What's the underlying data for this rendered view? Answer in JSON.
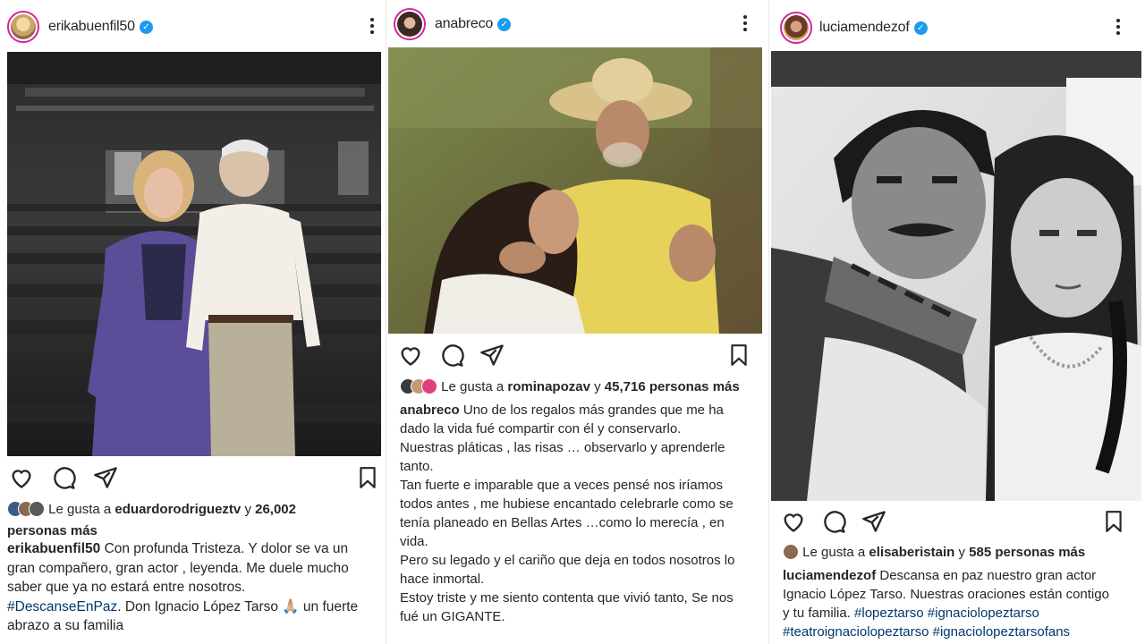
{
  "posts": [
    {
      "username": "erikabuenfil50",
      "likes_prefix": "Le gusta a",
      "liked_by": "eduardorodrigueztv",
      "likes_mid": "y",
      "likes_count": "26,002",
      "likes_suffix": "personas más",
      "caption_user": "erikabuenfil50",
      "caption_lines": [
        "Con profunda Tristeza. Y dolor se va un",
        "gran compañero, gran actor , leyenda. Me duele mucho",
        "saber que ya no estará entre nosotros."
      ],
      "hashtag": "#DescanseEnPaz",
      "caption_tail": ". Don Ignacio López Tarso 🙏🏼 un fuerte",
      "caption_last": "abrazo a su familia"
    },
    {
      "username": "anabreco",
      "likes_prefix": "Le gusta a",
      "liked_by": "rominapozav",
      "likes_mid": "y",
      "likes_count": "45,716 personas más",
      "caption_user": "anabreco",
      "caption_first": "Uno de los regalos más grandes que me ha",
      "caption_lines": [
        "dado la vida fué compartir con él y conservarlo.",
        "Nuestras pláticas , las risas … observarlo y aprenderle",
        "tanto.",
        "Tan fuerte e imparable que a veces pensé nos iríamos",
        "todos antes , me hubiese encantado celebrarle como se",
        "tenía planeado en Bellas Artes …como lo merecía , en",
        "vida.",
        "Pero su legado y el cariño que deja en todos nosotros lo",
        "hace inmortal.",
        "Estoy triste y me siento contenta que vivió tanto, Se nos",
        "fué un GIGANTE."
      ]
    },
    {
      "username": "luciamendezof",
      "likes_prefix": "Le gusta a",
      "liked_by": "elisaberistain",
      "likes_mid": "y",
      "likes_count": "585 personas más",
      "caption_user": "luciamendezof",
      "caption_first": "Descansa en paz nuestro gran actor",
      "caption_lines": [
        "Ignacio López Tarso. Nuestras oraciones están contigo"
      ],
      "caption_third": "y tu familia.",
      "hashtags": [
        "#lopeztarso",
        "#ignaciolopeztarso",
        "#teatroignaciolopeztarso",
        "#ignaciolopeztarsofans"
      ]
    }
  ],
  "colors": {
    "text": "#262626",
    "hashtag": "#00376b",
    "verified": "#1d9bf0"
  },
  "icons": [
    "heart-icon",
    "comment-icon",
    "share-icon",
    "bookmark-icon",
    "more-icon",
    "verified-icon"
  ]
}
